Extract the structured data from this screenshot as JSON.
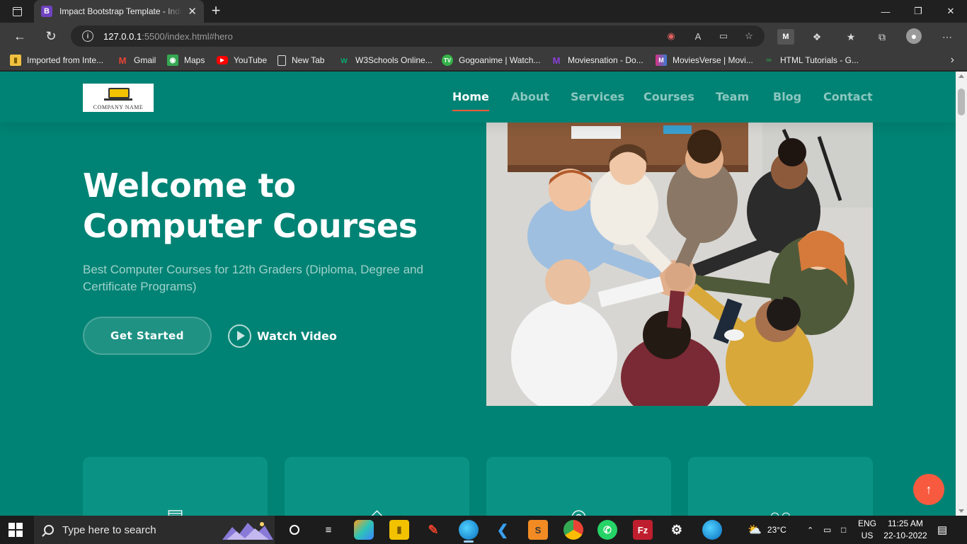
{
  "browser": {
    "tab": {
      "favicon": "B",
      "title": "Impact Bootstrap Template - Index",
      "close": "✕"
    },
    "new_tab": "+",
    "window_controls": {
      "minimize": "—",
      "maximize": "❐",
      "close": "✕"
    },
    "address": {
      "host": "127.0.0.1",
      "rest": ":5500/index.html#hero"
    },
    "bookmarks": [
      {
        "label": "Imported from Inte...",
        "icon": "folder-icon",
        "color": "#f0c040"
      },
      {
        "label": "Gmail",
        "icon": "gmail-icon",
        "color": "#ea4335"
      },
      {
        "label": "Maps",
        "icon": "maps-icon",
        "color": "#34a853"
      },
      {
        "label": "YouTube",
        "icon": "youtube-icon",
        "color": "#ff0000"
      },
      {
        "label": "New Tab",
        "icon": "page-icon",
        "color": "#cccccc"
      },
      {
        "label": "W3Schools Online...",
        "icon": "w3schools-icon",
        "color": "#04aa6d"
      },
      {
        "label": "Gogoanime | Watch...",
        "icon": "gogoanime-icon",
        "color": "#35b24a"
      },
      {
        "label": "Moviesnation - Do...",
        "icon": "moviesnation-icon",
        "color": "#8b3fd9"
      },
      {
        "label": "MoviesVerse | Movi...",
        "icon": "moviesverse-icon",
        "color": "#d63384"
      },
      {
        "label": "HTML Tutorials - G...",
        "icon": "gfg-icon",
        "color": "#2f8d46"
      }
    ]
  },
  "site": {
    "logo_text": "COMPANY NAME",
    "nav": [
      "Home",
      "About",
      "Services",
      "Courses",
      "Team",
      "Blog",
      "Contact"
    ],
    "active_nav": "Home",
    "hero": {
      "title_line1": "Welcome to",
      "title_line2": "Computer Courses",
      "subtitle": "Best Computer Courses for 12th Graders (Diploma, Degree and Certificate Programs)",
      "cta_primary": "Get Started",
      "cta_video": "Watch Video"
    },
    "cards": [
      {
        "icon": "easel-icon"
      },
      {
        "icon": "gem-icon"
      },
      {
        "icon": "target-icon"
      },
      {
        "icon": "people-icon"
      }
    ],
    "accent_color": "#008374",
    "highlight_color": "#f85a40"
  },
  "taskbar": {
    "search_placeholder": "Type here to search",
    "weather": "23°C",
    "language": {
      "line1": "ENG",
      "line2": "US"
    },
    "clock": {
      "time": "11:25 AM",
      "date": "22-10-2022"
    }
  }
}
